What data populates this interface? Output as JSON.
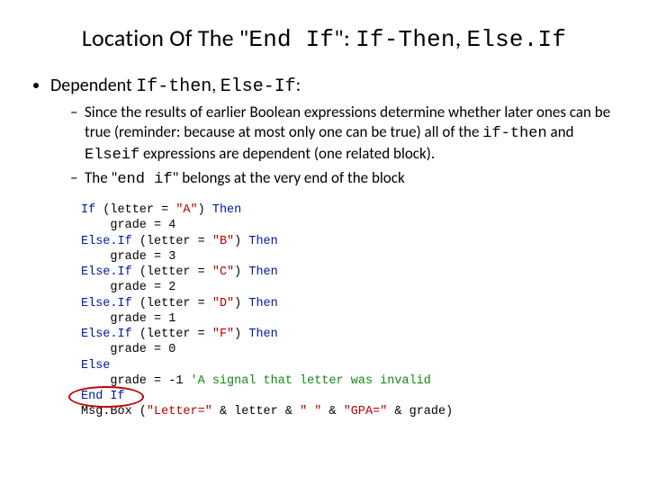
{
  "title": {
    "pre": "Location Of The \"",
    "code1": "End If",
    "mid": "\": ",
    "code2": "If-Then",
    "sep": ", ",
    "code3": "Else.If"
  },
  "bullets": {
    "top": {
      "pre": "Dependent ",
      "code1": "If-then",
      "mid": ", ",
      "code2": "Else-If",
      "post": ":"
    },
    "sub1": {
      "pre": "Since the results of earlier Boolean expressions determine whether later ones can be true (reminder: because at most only one can be true) all of the ",
      "code1": "if-then",
      "mid": " and ",
      "code2": "Elseif",
      "post": " expressions are dependent (one related block)."
    },
    "sub2": {
      "pre": "The \"",
      "code1": "end if",
      "post": "\" belongs at the very end of the block"
    }
  },
  "code": {
    "l1_kw1": "If",
    "l1_txt1": " (letter = ",
    "l1_str": "\"A\"",
    "l1_txt2": ") ",
    "l1_kw2": "Then",
    "l2": "    grade = 4",
    "l3_kw1": "Else.If",
    "l3_txt1": " (letter = ",
    "l3_str": "\"B\"",
    "l3_txt2": ") ",
    "l3_kw2": "Then",
    "l4": "    grade = 3",
    "l5_kw1": "Else.If",
    "l5_txt1": " (letter = ",
    "l5_str": "\"C\"",
    "l5_txt2": ") ",
    "l5_kw2": "Then",
    "l6": "    grade = 2",
    "l7_kw1": "Else.If",
    "l7_txt1": " (letter = ",
    "l7_str": "\"D\"",
    "l7_txt2": ") ",
    "l7_kw2": "Then",
    "l8": "    grade = 1",
    "l9_kw1": "Else.If",
    "l9_txt1": " (letter = ",
    "l9_str": "\"F\"",
    "l9_txt2": ") ",
    "l9_kw2": "Then",
    "l10": "    grade = 0",
    "l11_kw": "Else",
    "l12_txt": "    grade = -1 ",
    "l12_cm": "'A signal that letter was invalid",
    "l13_kw": "End If",
    "l14_txt1": "Msg.Box (",
    "l14_str1": "\"Letter=\"",
    "l14_txt2": " & letter & ",
    "l14_str2": "\" \"",
    "l14_txt3": " & ",
    "l14_str3": "\"GPA=\"",
    "l14_txt4": " & grade)"
  }
}
